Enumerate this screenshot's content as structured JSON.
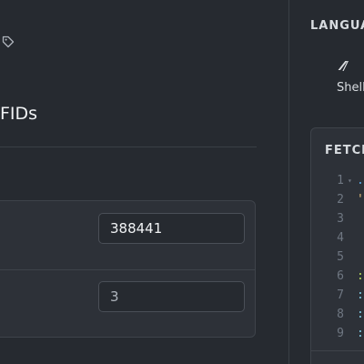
{
  "left_panel": {
    "title": "FIDs",
    "fields": [
      {
        "value": "388441"
      },
      {
        "value": "3"
      }
    ]
  },
  "right_panel": {
    "language_heading": "LANGUAGE",
    "language": {
      "icon": "shell-icon",
      "glyph": "⁄⁄/",
      "label": "Shell"
    },
    "code_card": {
      "heading": "FETCH",
      "lines": [
        {
          "number": "1",
          "fold": "▾",
          "text": ".o",
          "color": "#5aa9e6"
        },
        {
          "number": "2",
          "fold": "",
          "text": "'",
          "color": "#e6c07b"
        },
        {
          "number": "3",
          "fold": "",
          "text": "",
          "color": "#e6e8eb"
        },
        {
          "number": "4",
          "fold": "",
          "text": "",
          "color": "#e6e8eb"
        },
        {
          "number": "5",
          "fold": "",
          "text": "",
          "color": "#e6e8eb"
        },
        {
          "number": "6",
          "fold": "",
          "text": ":p",
          "color": "#b5d65c"
        },
        {
          "number": "7",
          "fold": "",
          "text": ":s",
          "color": "#7fc8e0"
        },
        {
          "number": "8",
          "fold": "",
          "text": ":s",
          "color": "#7fc8e0"
        },
        {
          "number": "9",
          "fold": "",
          "text": ":r",
          "color": "#7fc8e0"
        }
      ]
    }
  }
}
